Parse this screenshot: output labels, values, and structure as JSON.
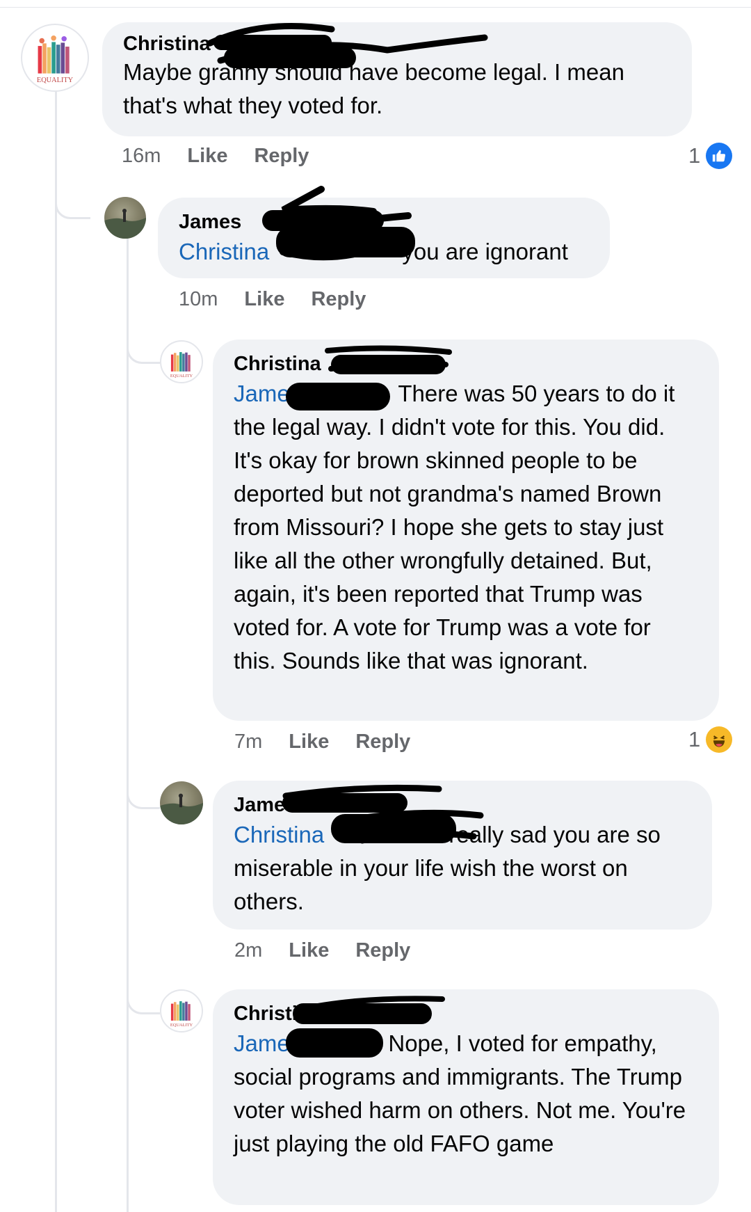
{
  "comments": [
    {
      "author": "Christina",
      "text": "Maybe granny should have become legal. I mean that's what they voted for.",
      "time": "16m",
      "like_label": "Like",
      "reply_label": "Reply",
      "reaction_count": "1",
      "reaction_icon": "like-icon"
    },
    {
      "author": "James",
      "mention": "Christina",
      "text": "you are ignorant",
      "time": "10m",
      "like_label": "Like",
      "reply_label": "Reply"
    },
    {
      "author": "Christina",
      "mention": "James",
      "text": "There was 50 years to do it the legal way. I didn't vote for this.  You did. It's okay for brown skinned people to be deported but not grandma's named Brown from Missouri? I hope she gets to stay just like all the other wrongfully detained. But, again, it's been reported that Trump was voted for. A vote for Trump was a vote for this.  Sounds like that was ignorant.",
      "time": "7m",
      "like_label": "Like",
      "reply_label": "Reply",
      "reaction_count": "1",
      "reaction_icon": "haha-icon"
    },
    {
      "author": "James",
      "mention": "Christina",
      "text": "really sad you are so miserable in your life wish the worst on others.",
      "time": "2m",
      "like_label": "Like",
      "reply_label": "Reply"
    },
    {
      "author": "Christina",
      "mention": "James",
      "text": "Nope, I voted for empathy, social programs and immigrants. The Trump voter wished harm on others.  Not me. You're just playing the old FAFO game"
    }
  ],
  "avatar_logo_text": "EQUALITY",
  "colors": {
    "bubble": "#f0f2f5",
    "mention": "#1a67b8",
    "meta": "#65676b",
    "like_blue": "#1877f2",
    "haha_yellow": "#f7b928"
  }
}
